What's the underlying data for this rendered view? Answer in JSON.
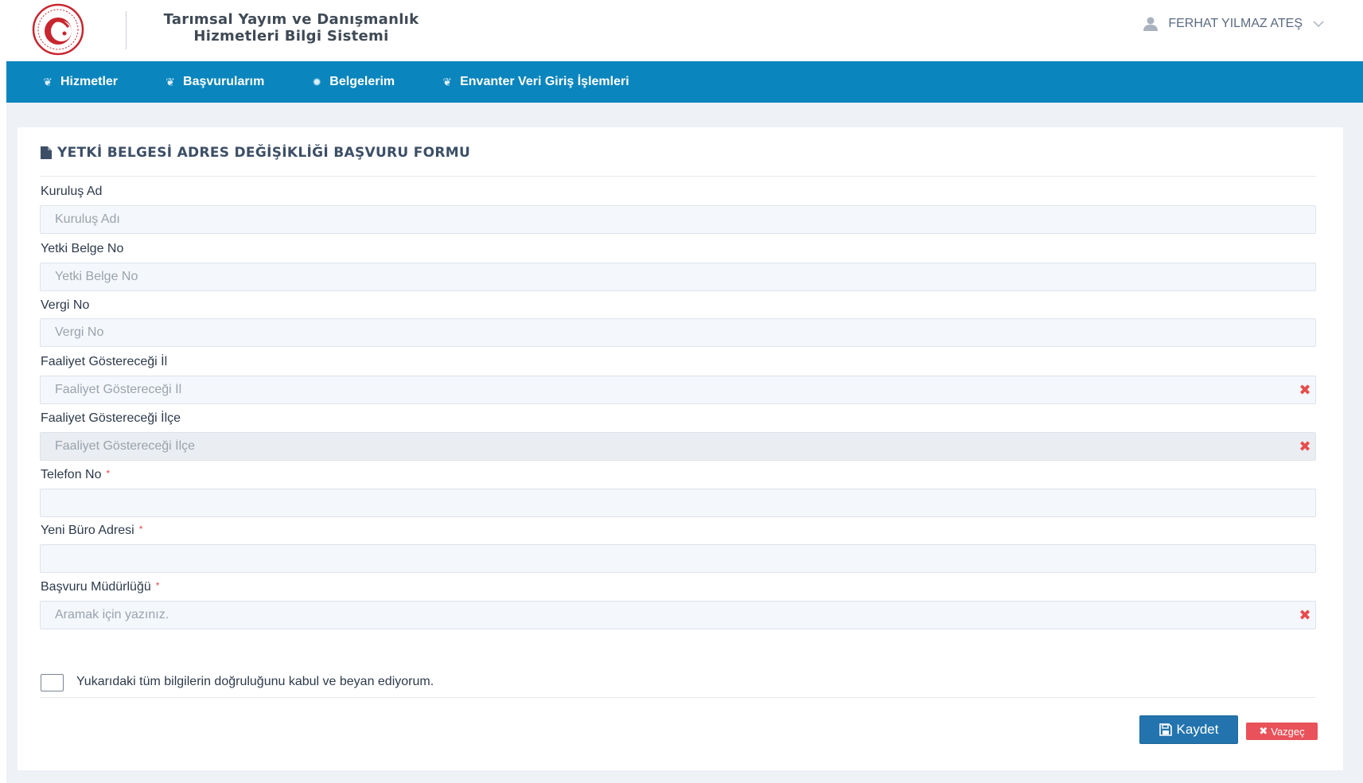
{
  "header": {
    "app_title_line1": "Tarımsal Yayım ve Danışmanlık",
    "app_title_line2": "Hizmetleri Bilgi Sistemi",
    "user_name": "FERHAT YILMAZ ATEŞ",
    "logo_icon": "ministry-seal-icon",
    "user_icon": "user-icon",
    "dropdown_icon": "chevron-down-icon"
  },
  "nav": {
    "items": [
      {
        "label": "Hizmetler",
        "icon": "leaf-icon"
      },
      {
        "label": "Başvurularım",
        "icon": "leaf-icon"
      },
      {
        "label": "Belgelerim",
        "icon": "badge-icon"
      },
      {
        "label": "Envanter Veri Giriş İşlemleri",
        "icon": "leaf-icon"
      }
    ]
  },
  "form": {
    "title": "YETKİ BELGESİ ADRES DEĞİŞİKLİĞİ BAŞVURU FORMU",
    "title_icon": "file-icon",
    "fields": [
      {
        "label": "Kuruluş Ad",
        "placeholder": "Kuruluş Adı",
        "value": "",
        "required": false
      },
      {
        "label": "Yetki Belge No",
        "placeholder": "Yetki Belge No",
        "value": "",
        "required": false
      },
      {
        "label": "Vergi No",
        "placeholder": "Vergi No",
        "value": "",
        "required": false
      },
      {
        "label": "Faaliyet Göstereceği İl",
        "placeholder": "Faaliyet Göstereceği İl",
        "value": "",
        "required": false,
        "clearable": true
      },
      {
        "label": "Faaliyet Göstereceği İlçe",
        "placeholder": "Faaliyet Göstereceği İlçe",
        "value": "",
        "required": false,
        "clearable": true,
        "disabled": true
      },
      {
        "label": "Telefon No",
        "placeholder": "",
        "value": "",
        "required": true
      },
      {
        "label": "Yeni Büro Adresi",
        "placeholder": "",
        "value": "",
        "required": true
      },
      {
        "label": "Başvuru Müdürlüğü",
        "placeholder": "Aramak için yazınız.",
        "value": "",
        "required": true,
        "clearable": true
      }
    ],
    "required_mark": "*",
    "clear_symbol": "✖",
    "declaration": "Yukarıdaki tüm bilgilerin doğruluğunu kabul ve beyan ediyorum.",
    "declaration_checked": false,
    "save_label": "Kaydet",
    "save_icon": "save-icon",
    "cancel_label": "Vazgeç",
    "cancel_icon": "close-icon"
  },
  "colors": {
    "nav_bg": "#0a85bd",
    "save_btn": "#2374ae",
    "cancel_btn": "#e9525a",
    "required": "#e04b4b"
  }
}
